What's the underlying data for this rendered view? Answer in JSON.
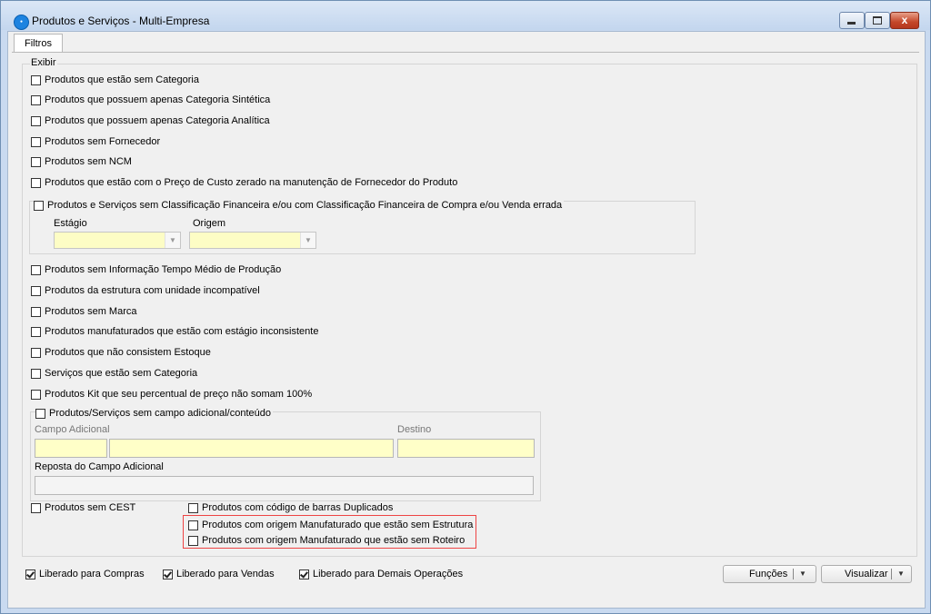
{
  "window": {
    "title": "Produtos e Serviços - Multi-Empresa",
    "icon": "app-logo-icon",
    "close_glyph": "x"
  },
  "tabs": [
    {
      "label": "Filtros"
    }
  ],
  "exibir": {
    "legend": "Exibir",
    "options": [
      {
        "label": "Produtos que estão sem Categoria",
        "checked": false
      },
      {
        "label": "Produtos que possuem apenas Categoria Sintética",
        "checked": false
      },
      {
        "label": "Produtos que possuem apenas Categoria Analítica",
        "checked": false
      },
      {
        "label": "Produtos sem Fornecedor",
        "checked": false
      },
      {
        "label": "Produtos sem NCM",
        "checked": false
      },
      {
        "label": "Produtos que estão com o Preço de Custo zerado na manutenção de Fornecedor do Produto",
        "checked": false
      }
    ],
    "classificacao": {
      "label": "Produtos e Serviços sem Classificação Financeira e/ou com Classificação Financeira de Compra e/ou Venda errada",
      "checked": false,
      "estagio_label": "Estágio",
      "estagio_value": "",
      "origem_label": "Origem",
      "origem_value": ""
    },
    "options2": [
      {
        "label": "Produtos sem Informação Tempo Médio de Produção",
        "checked": false
      },
      {
        "label": "Produtos da estrutura com unidade incompatível",
        "checked": false
      },
      {
        "label": "Produtos sem Marca",
        "checked": false
      },
      {
        "label": "Produtos manufaturados que estão com estágio inconsistente",
        "checked": false
      },
      {
        "label": "Produtos que não consistem Estoque",
        "checked": false
      },
      {
        "label": "Serviços que estão sem Categoria",
        "checked": false
      },
      {
        "label": "Produtos Kit que seu percentual de preço não somam 100%",
        "checked": false
      }
    ],
    "campo_adicional": {
      "label": "Produtos/Serviços sem campo adicional/conteúdo",
      "checked": false,
      "campo_label": "Campo Adicional",
      "destino_label": "Destino",
      "resposta_label": "Reposta do Campo Adicional",
      "campo_code": "",
      "campo_desc": "",
      "destino_value": "",
      "resposta_value": ""
    },
    "bottom": {
      "cest": {
        "label": "Produtos sem CEST",
        "checked": false
      },
      "barras": {
        "label": "Produtos com código de barras Duplicados",
        "checked": false
      },
      "sem_estrutura": {
        "label": "Produtos com origem Manufaturado que estão sem Estrutura",
        "checked": false
      },
      "sem_roteiro": {
        "label": "Produtos com origem Manufaturado que estão sem Roteiro",
        "checked": false
      }
    }
  },
  "footer": {
    "compras": {
      "label": "Liberado para Compras",
      "checked": true
    },
    "vendas": {
      "label": "Liberado para Vendas",
      "checked": true
    },
    "demais": {
      "label": "Liberado para Demais Operações",
      "checked": true
    },
    "funcoes_label": "Funções",
    "visualizar_label": "Visualizar"
  },
  "colors": {
    "highlight_border": "#e44444",
    "required_field": "#ffffc8"
  }
}
